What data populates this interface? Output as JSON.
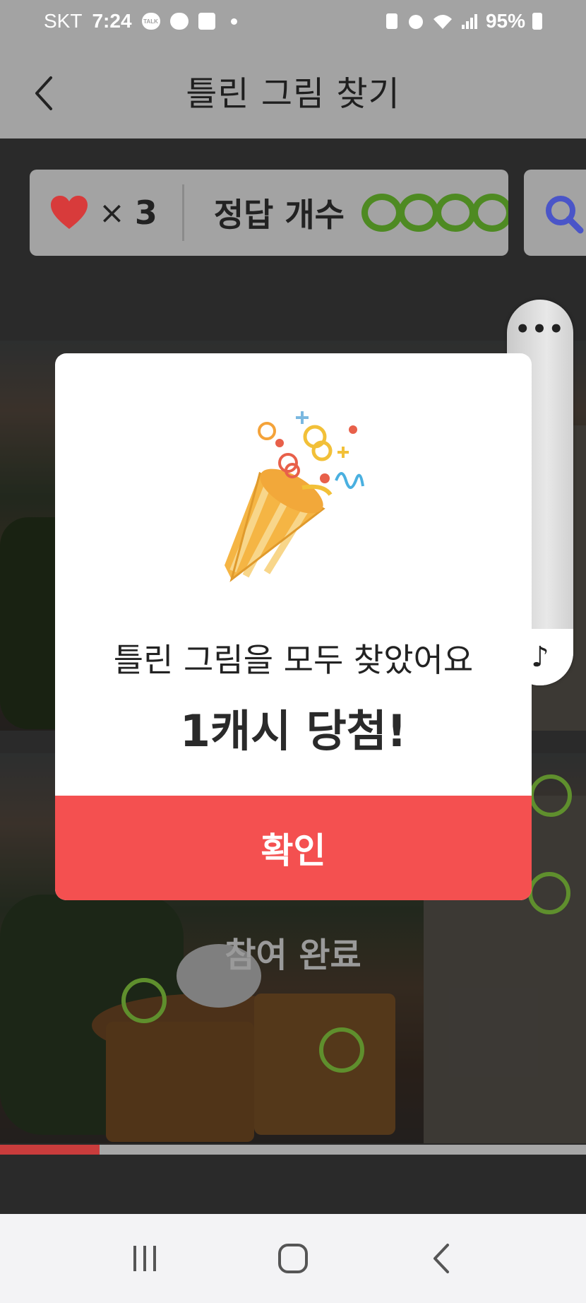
{
  "status_bar": {
    "carrier": "SKT",
    "time": "7:24",
    "battery_percent": "95%"
  },
  "header": {
    "title": "틀린 그림 찾기"
  },
  "game_info": {
    "lives_symbol": "×",
    "lives_count": "3",
    "answers_label": "정답 개수",
    "answers_found": 4
  },
  "photo": {
    "completed_label": "참여 완료",
    "progress_fraction": 0.17
  },
  "modal": {
    "message": "틀린 그림을 모두 찾았어요",
    "reward": "1캐시 당첨!",
    "confirm_label": "확인"
  },
  "colors": {
    "accent": "#f45050",
    "ring": "#4e8a22",
    "heart": "#d83b3b"
  }
}
